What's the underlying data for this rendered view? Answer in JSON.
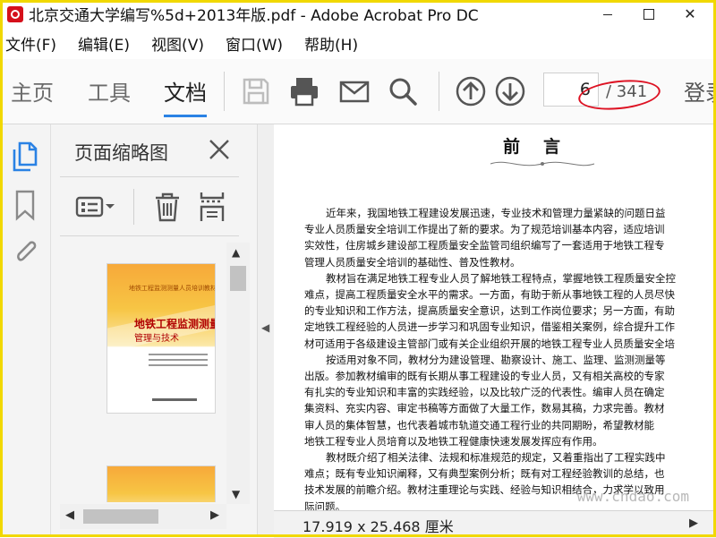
{
  "window": {
    "title": "北京交通大学编写%5d+2013年版.pdf - Adobe Acrobat Pro DC",
    "min_label": "—",
    "close_label": "✕"
  },
  "menu": [
    "文件(F)",
    "编辑(E)",
    "视图(V)",
    "窗口(W)",
    "帮助(H)"
  ],
  "toolbar": {
    "tabs": [
      "主页",
      "工具",
      "文档"
    ],
    "active_tab": "文档",
    "icons": [
      "save-icon",
      "print-icon",
      "mail-icon",
      "search-icon",
      "page-up-icon",
      "page-down-icon"
    ],
    "page_current": "6",
    "page_total": "/ 341",
    "login": "登录",
    "annotation_color": "#dd1122",
    "accent": "#2a82e4"
  },
  "nav_rail": {
    "icons": [
      "page-thumbnails-icon",
      "bookmark-icon",
      "attachment-icon"
    ],
    "active_color": "#2a82e4"
  },
  "thumb_panel": {
    "title": "页面缩略图",
    "close_label": "✕",
    "tools": [
      "options-menu-icon",
      "delete-icon",
      "crop-icon"
    ],
    "thumbnail_1": {
      "top_text": "地铁工程监测测量人员培训教材",
      "title": "地铁工程监测测量",
      "subtitle": "管理与技术",
      "page_label": "1"
    }
  },
  "document": {
    "heading": "前言",
    "paragraphs": [
      "近年来，我国地铁工程建设发展迅速，专业技术和管理力量紧缺的问题日益",
      "专业人员质量安全培训工作提出了新的要求。为了规范培训基本内容，适应培训",
      "实效性，住房城乡建设部工程质量安全监管司组织编写了一套适用于地铁工程专",
      "管理人员质量安全培训的基础性、普及性教材。",
      "教材旨在满足地铁工程专业人员了解地铁工程特点，掌握地铁工程质量安全控",
      "难点，提高工程质量安全水平的需求。一方面，有助于新从事地铁工程的人员尽快",
      "的专业知识和工作方法，提高质量安全意识，达到工作岗位要求；另一方面，有助",
      "定地铁工程经验的人员进一步学习和巩固专业知识，借鉴相关案例，综合提升工作",
      "材可适用于各级建设主管部门或有关企业组织开展的地铁工程专业人员质量安全培",
      "按适用对象不同，教材分为建设管理、勘察设计、施工、监理、监测测量等",
      "出版。参加教材编审的既有长期从事工程建设的专业人员，又有相关高校的专家",
      "有扎实的专业知识和丰富的实践经验，以及比较广泛的代表性。编审人员在确定",
      "集资料、充实内容、审定书稿等方面做了大量工作，数易其稿，力求完善。教材",
      "审人员的集体智慧，也代表着城市轨道交通工程行业的共同期盼，希望教材能",
      "地铁工程专业人员培育以及地铁工程健康快速发展发挥应有作用。",
      "教材既介绍了相关法律、法规和标准规范的规定，又着重指出了工程实践中",
      "难点；既有专业知识阐释，又有典型案例分析；既有对工程经验教训的总结，也",
      "技术发展的前瞻介绍。教材注重理论与实践、经验与知识相结合，力求学以致用",
      "际问题。"
    ],
    "watermark": "www.cndao.com"
  },
  "status": {
    "page_size": "17.919 x 25.468 厘米"
  }
}
